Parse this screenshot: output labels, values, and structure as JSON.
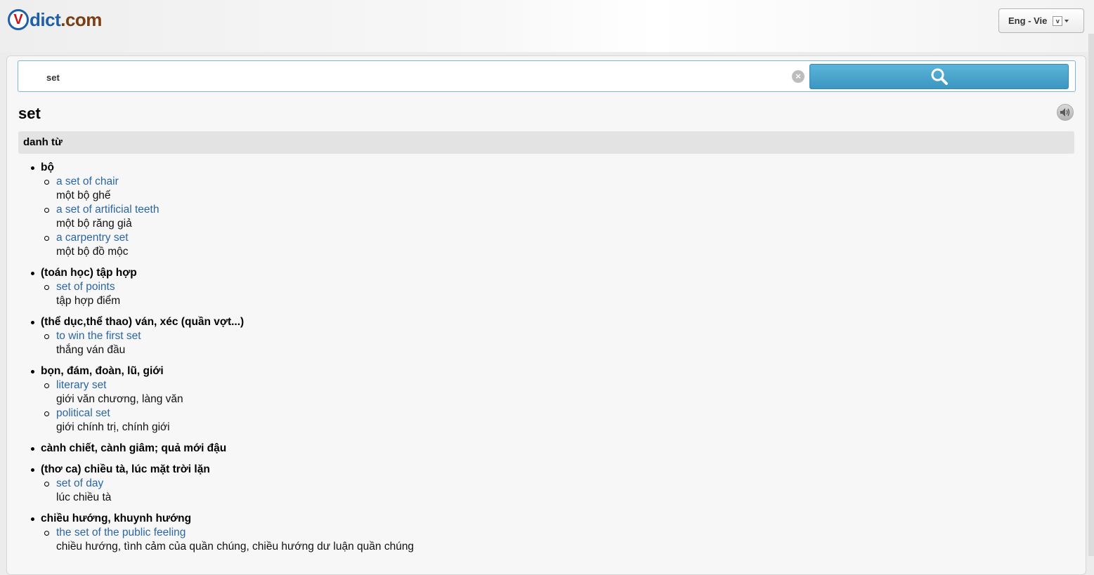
{
  "header": {
    "logo_letter": "V",
    "logo_dict": "dict",
    "logo_com": ".com",
    "lang_label": "Eng - Vie",
    "lang_mini": "v"
  },
  "search": {
    "query": "set",
    "clear_symbol": "×",
    "search_icon": "magnifier-icon"
  },
  "entry": {
    "word": "set",
    "speaker_icon": "speaker-icon",
    "part_of_speech": "danh từ",
    "senses": [
      {
        "label": "bộ",
        "examples": [
          {
            "en": "a set of chair",
            "vi": "một bộ ghế"
          },
          {
            "en": "a set of artificial teeth",
            "vi": "một bộ răng giả"
          },
          {
            "en": "a carpentry set",
            "vi": "một bộ đồ mộc"
          }
        ]
      },
      {
        "label": "(toán học) tập hợp",
        "examples": [
          {
            "en": "set of points",
            "vi": "tập hợp điểm"
          }
        ]
      },
      {
        "label": "(thể dục,thể thao) ván, xéc (quần vợt...)",
        "examples": [
          {
            "en": "to win the first set",
            "vi": "thắng ván đầu"
          }
        ]
      },
      {
        "label": "bọn, đám, đoàn, lũ, giới",
        "examples": [
          {
            "en": "literary set",
            "vi": "giới văn chương, làng văn"
          },
          {
            "en": "political set",
            "vi": "giới chính trị, chính giới"
          }
        ]
      },
      {
        "label": "cành chiết, cành giâm; quả mới đậu",
        "examples": []
      },
      {
        "label": "(thơ ca) chiều tà, lúc mặt trời lặn",
        "examples": [
          {
            "en": "set of day",
            "vi": "lúc chiều tà"
          }
        ]
      },
      {
        "label": "chiều hướng, khuynh hướng",
        "examples": [
          {
            "en": "the set of the public feeling",
            "vi": "chiều hướng, tình cảm của quần chúng, chiều hướng dư luận quần chúng"
          }
        ]
      }
    ]
  },
  "colors": {
    "link": "#2a66a4",
    "search_button": "#4aa5cd",
    "logo_blue": "#1f5fa8",
    "logo_red": "#c4161c",
    "logo_brown": "#7a3d14"
  }
}
